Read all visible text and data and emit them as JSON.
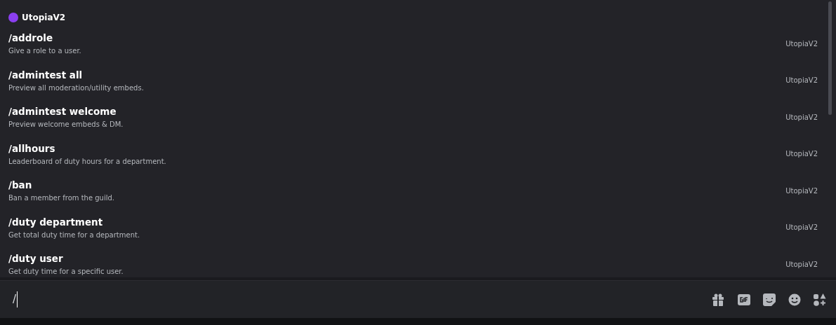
{
  "header": {
    "title": "UtopiaV2"
  },
  "commands": [
    {
      "name": "/addrole",
      "description": "Give a role to a user.",
      "source": "UtopiaV2"
    },
    {
      "name": "/admintest all",
      "description": "Preview all moderation/utility embeds.",
      "source": "UtopiaV2"
    },
    {
      "name": "/admintest welcome",
      "description": "Preview welcome embeds & DM.",
      "source": "UtopiaV2"
    },
    {
      "name": "/allhours",
      "description": "Leaderboard of duty hours for a department.",
      "source": "UtopiaV2"
    },
    {
      "name": "/ban",
      "description": "Ban a member from the guild.",
      "source": "UtopiaV2"
    },
    {
      "name": "/duty department",
      "description": "Get total duty time for a department.",
      "source": "UtopiaV2"
    },
    {
      "name": "/duty user",
      "description": "Get duty time for a specific user.",
      "source": "UtopiaV2"
    }
  ],
  "message_input": {
    "value": "/"
  }
}
